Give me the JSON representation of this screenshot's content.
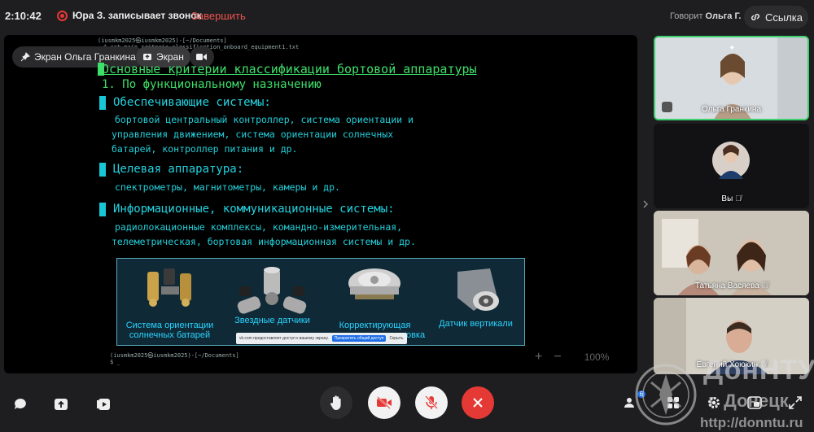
{
  "topbar": {
    "time": "2:10:42",
    "recording_text": "Юра З. записывает звонок",
    "end_recording_label": "Завершить",
    "speaking_prefix": "Говорит",
    "speaking_name": "Ольга Г.",
    "link_label": "Ссылка"
  },
  "screen": {
    "presenter_chip": "Экран Ольга Гранкина",
    "screen_chip": "Экран",
    "terminal_prompt_top": "(iusmkm2025㉿iusmkm2025)-[~/Documents]",
    "terminal_cmd_top": "$ cat main_criteria_classification_onboard_equipment1.txt",
    "terminal_prompt_bottom": "(iusmkm2025㉿iusmkm2025)-[~/Documents]",
    "terminal_cmd_bottom": "$ _",
    "slide_title": "Основные критерии классификации бортовой аппаратуры",
    "slide_subtitle": "1. По функциональному назначению",
    "sections": [
      {
        "heading": "Обеспечивающие системы:",
        "lines": [
          "бортовой центральный контроллер, система  ориентации  и",
          "управления  движением, система ориентации солнечных",
          "батарей, контроллер питания и др."
        ]
      },
      {
        "heading": "Целевая аппаратура:",
        "lines": [
          "спектрометры, магнитометры, камеры и др."
        ]
      },
      {
        "heading": "Информационные, коммуникационные системы:",
        "lines": [
          "радиолокационные комплексы, командно-измерительная,",
          "телеметрическая, бортовая информационная системы и др."
        ]
      }
    ],
    "images": [
      {
        "caption": "Система ориентации солнечных батарей"
      },
      {
        "caption": "Звездные датчики"
      },
      {
        "caption": "Корректирующая двигательная установка"
      },
      {
        "caption": "Датчик вертикали"
      }
    ],
    "share_note": {
      "text": "vk.com предоставляет доступ к вашему экрану.",
      "stop_label": "Прекратить общий доступ",
      "hide_label": "Скрыть"
    },
    "zoom": {
      "plus": "+",
      "minus": "−",
      "level": "100%"
    }
  },
  "participants": [
    {
      "name": "Ольга Гранкина",
      "bg": "#d9dee2",
      "active": true
    },
    {
      "name": "Вы",
      "bg": "#121214",
      "active": false
    },
    {
      "name": "Татьяна Васяева",
      "bg": "#c8c2b6",
      "active": false
    },
    {
      "name": "Евгений Хоюкин",
      "bg": "#d6d2c8",
      "active": false
    }
  ],
  "participants_count": "6",
  "watermark": {
    "line1": "ДонНТУ",
    "line2": "г. Донецк",
    "line3": "http://donntu.ru"
  },
  "colors": {
    "accent_red": "#e53935",
    "terminal_green": "#3ee06a",
    "terminal_cyan": "#22d3e0"
  }
}
